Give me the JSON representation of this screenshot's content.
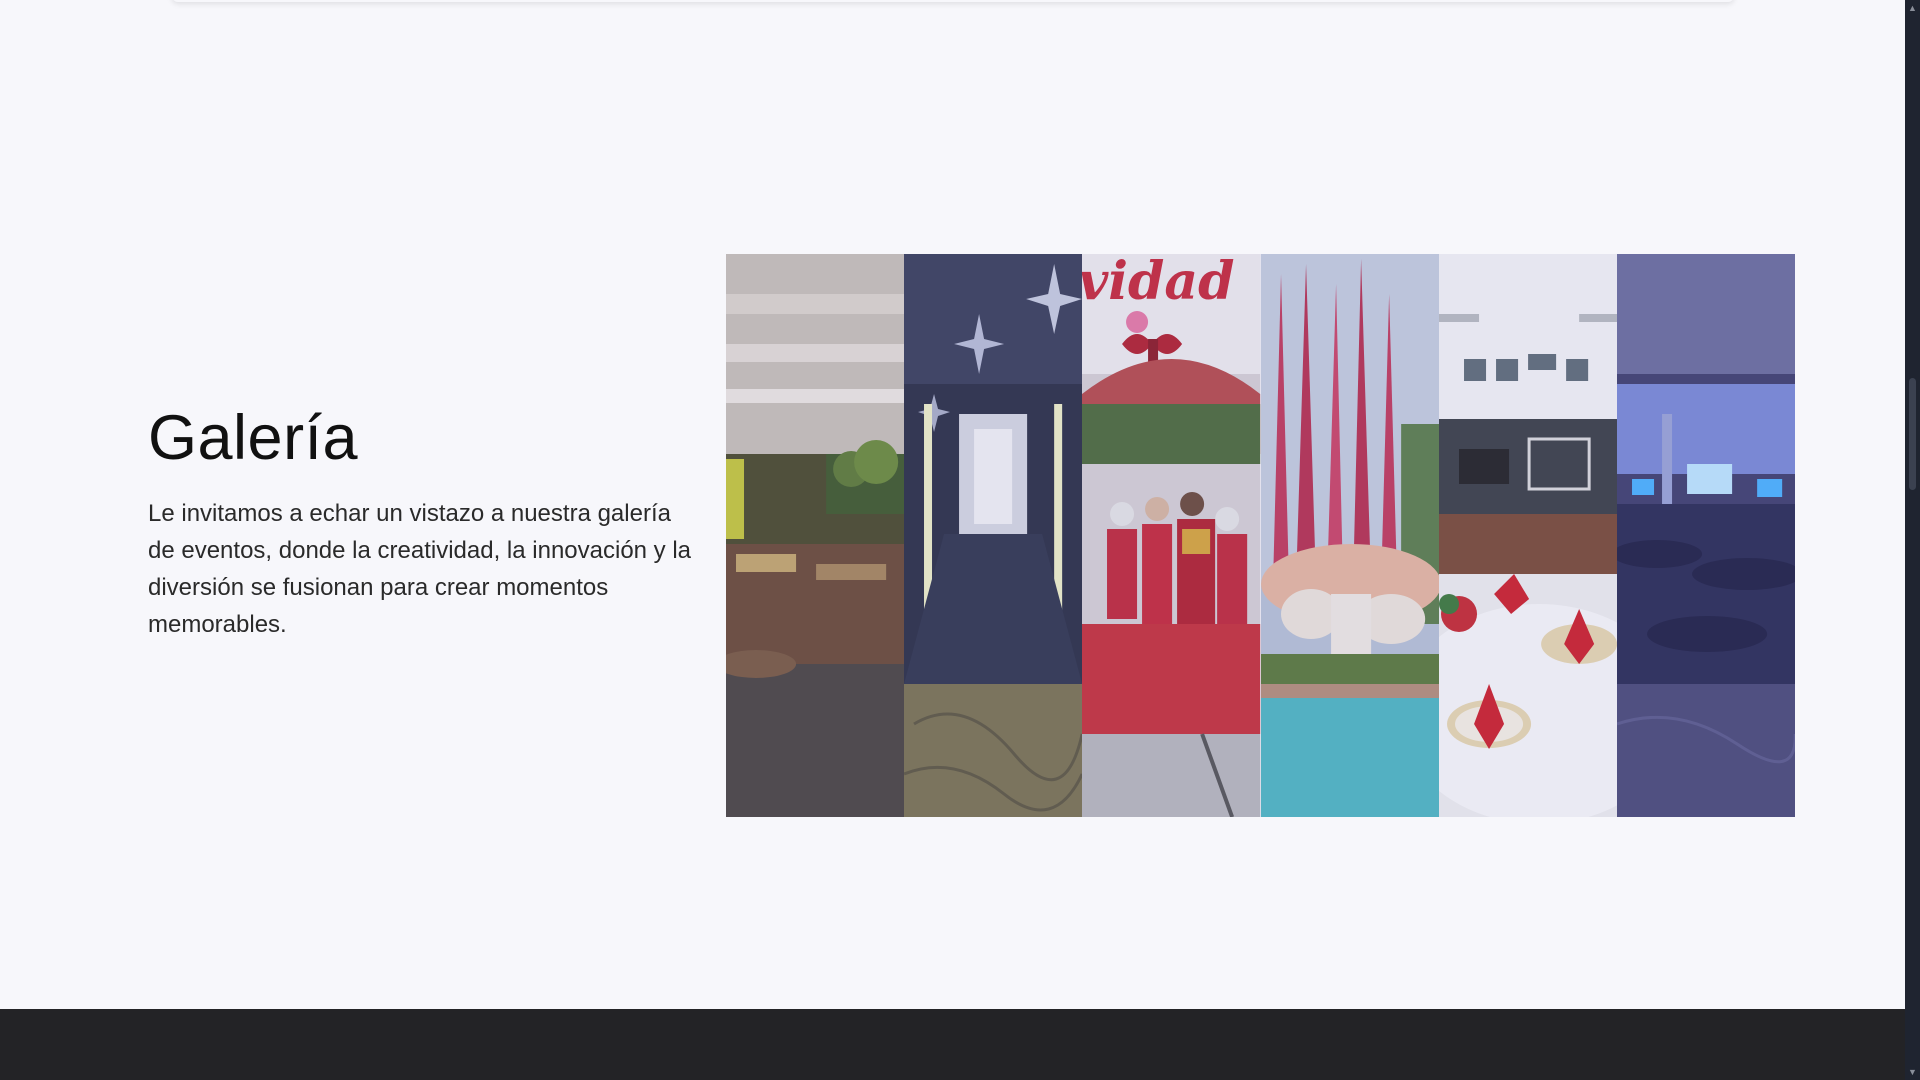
{
  "gallery": {
    "title": "Galería",
    "description": "Le invitamos a echar un vistazo a nuestra galería de eventos, donde la creatividad, la innovación y la diversión se fusionan para crear momentos memorables.",
    "images": [
      {
        "subject": "banquet-hall-greenery"
      },
      {
        "subject": "illuminated-walkway-stars"
      },
      {
        "subject": "navidad-costumed-group"
      },
      {
        "subject": "pink-smoke-garden-pool"
      },
      {
        "subject": "table-setting-red-napkins"
      },
      {
        "subject": "blue-lit-ballroom"
      }
    ],
    "sign_text": "vidad"
  },
  "colors": {
    "page_background": "#f7f7fb",
    "footer_background": "#232326",
    "scrollbar_track": "#1f2430"
  }
}
